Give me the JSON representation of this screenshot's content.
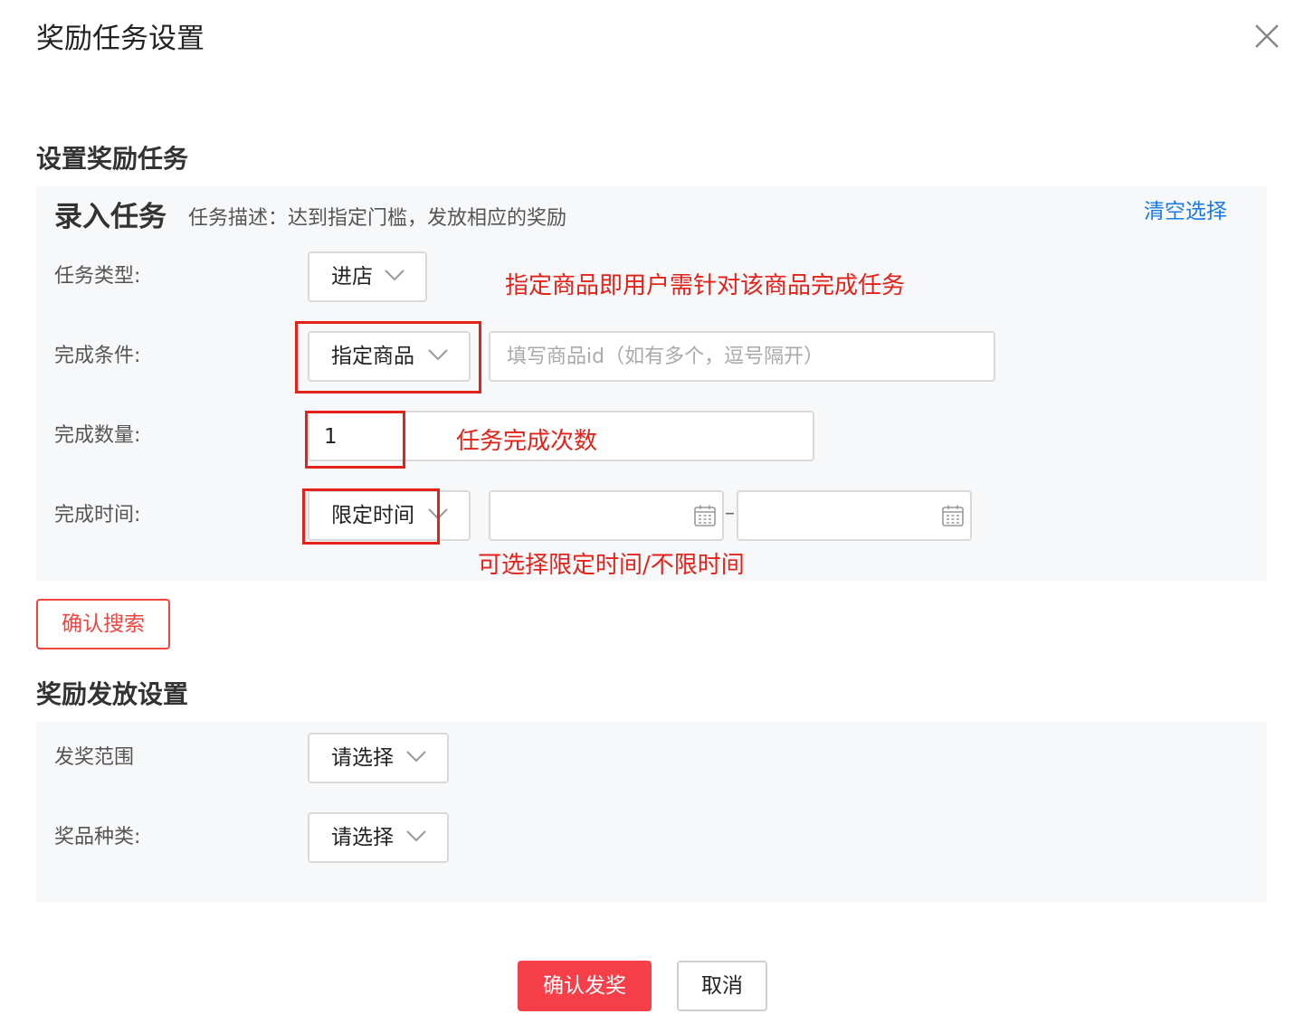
{
  "dialog": {
    "title": "奖励任务设置"
  },
  "task_section": {
    "title": "设置奖励任务",
    "heading": "录入任务",
    "description": "任务描述：达到指定门槛，发放相应的奖励",
    "clear_label": "清空选择",
    "fields": {
      "type": {
        "label": "任务类型:",
        "value": "进店"
      },
      "condition": {
        "label": "完成条件:",
        "value": "指定商品",
        "input_placeholder": "填写商品id（如有多个，逗号隔开）"
      },
      "quantity": {
        "label": "完成数量:",
        "value": "1"
      },
      "time": {
        "label": "完成时间:",
        "value": "限定时间",
        "separator": "–"
      }
    },
    "search_button": "确认搜索"
  },
  "annotations": {
    "condition_note": "指定商品即用户需针对该商品完成任务",
    "quantity_note": "任务完成次数",
    "time_note": "可选择限定时间/不限时间"
  },
  "reward_section": {
    "title": "奖励发放设置",
    "fields": {
      "scope": {
        "label": "发奖范围",
        "value": "请选择"
      },
      "kind": {
        "label": "奖品种类:",
        "value": "请选择"
      }
    }
  },
  "footer": {
    "confirm_label": "确认发奖",
    "cancel_label": "取消"
  },
  "colors": {
    "accent": "#f5404a",
    "link": "#1a7ae8",
    "annotation": "#e32219",
    "panel": "#f7f8fa"
  },
  "icons": {
    "close": "close-icon",
    "chevron": "chevron-down-icon",
    "calendar": "calendar-icon"
  }
}
